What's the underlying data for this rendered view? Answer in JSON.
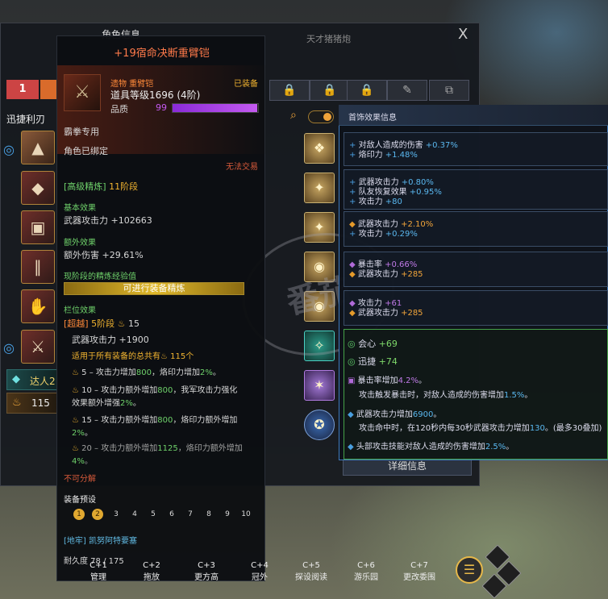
{
  "window": {
    "title": "角色信息",
    "subtitle": "天才猪猪炮",
    "close": "X",
    "tab_number": "1",
    "class_name": "迅捷利刃"
  },
  "left_panel": {
    "master_label": "达人2",
    "level_value": "115"
  },
  "detail_button": "详细信息",
  "tooltip": {
    "title": "+19宿命决断重臂铠",
    "category": "遗物 重臂铠",
    "equipped": "已装备",
    "item_level": "道具等级1696 (4阶)",
    "quality_label": "品质",
    "quality_value": "99",
    "quality_percent": 99,
    "class_restriction": "霸拳专用",
    "bound": "角色已绑定",
    "untradable": "无法交易",
    "refine_tag": "[高级精炼]",
    "refine_stage": "11阶段",
    "base_effect_header": "基本效果",
    "base_effect": "武器攻击力 +102663",
    "extra_effect_header": "额外效果",
    "extra_effect": "额外伤害 +29.61%",
    "refine_exp_header": "现阶段的精炼经验值",
    "refine_button": "可进行装备精炼",
    "slot_effect_header": "栏位效果",
    "transcend_tag": "[超越]",
    "transcend_stage": "5阶段",
    "transcend_value": "15",
    "weapon_attack": "武器攻击力 +1900",
    "total_all_prefix": "适用于所有装备的总共有",
    "total_all_value": "115个",
    "tier5_prefix": "5 – 攻击力增加",
    "tier5_value": "800",
    "tier5_suffix": "，烙印力增加",
    "tier5_value2": "2%",
    "tier5_end": "。",
    "tier10_prefix": "10 – 攻击力额外增加",
    "tier10_value": "800",
    "tier10_suffix": "，我军攻击力强化",
    "tier10_line2_prefix": "效果额外增强",
    "tier10_value2": "2%",
    "tier10_end": "。",
    "tier15_prefix": "15 – 攻击力额外增加",
    "tier15_value": "800",
    "tier15_suffix": "，烙印力额外增加",
    "tier15_value2": "2%",
    "tier15_end": "。",
    "tier20_prefix": "20 – 攻击力额外增加",
    "tier20_value": "1125",
    "tier20_suffix": "，烙印力额外增加",
    "tier20_value2": "4%",
    "tier20_end": "。",
    "indivisible": "不可分解",
    "preset_header": "装备预设",
    "presets": [
      "1",
      "2",
      "3",
      "4",
      "5",
      "6",
      "7",
      "8",
      "9",
      "10"
    ],
    "active_presets": 2,
    "dungeon": "[地牢] 凯努阿特要塞",
    "durability": "耐久度 78 / 175"
  },
  "accessory": {
    "header": "首饰效果信息",
    "groups": [
      [
        {
          "dot": "+",
          "c": "b",
          "label": "对敌人造成的伤害",
          "val": "+0.37%"
        },
        {
          "dot": "+",
          "c": "b",
          "label": "烙印力",
          "val": "+1.48%"
        }
      ],
      [
        {
          "dot": "+",
          "c": "b",
          "label": "武器攻击力",
          "val": "+0.80%"
        },
        {
          "dot": "+",
          "c": "b",
          "label": "队友恢复效果",
          "val": "+0.95%"
        },
        {
          "dot": "+",
          "c": "b",
          "label": "攻击力",
          "val": "+80"
        }
      ],
      [
        {
          "dot": "◆",
          "c": "o",
          "label": "武器攻击力",
          "val": "+2.10%"
        },
        {
          "dot": "+",
          "c": "b",
          "label": "攻击力",
          "val": "+0.29%"
        }
      ],
      [
        {
          "dot": "◆",
          "c": "p",
          "label": "暴击率",
          "val": "+0.66%"
        },
        {
          "dot": "◆",
          "c": "o",
          "label": "武器攻击力",
          "val": "+285"
        }
      ],
      [
        {
          "dot": "◆",
          "c": "p",
          "label": "攻击力",
          "val": "+61"
        },
        {
          "dot": "◆",
          "c": "o",
          "label": "武器攻击力",
          "val": "+285"
        }
      ]
    ],
    "set": {
      "crit": "会心",
      "crit_val": "+69",
      "swift": "迅捷",
      "swift_val": "+74",
      "crit_rate_prefix": "暴击率增加",
      "crit_rate_val": "4.2%",
      "crit_rate_end": "。",
      "crit_dmg_prefix": "攻击触发暴击时，对敌人造成的伤害增加",
      "crit_dmg_val": "1.5%",
      "crit_dmg_end": "。",
      "wpn_prefix": "武器攻击力增加",
      "wpn_val": "6900",
      "wpn_end": "。",
      "stack_prefix": "攻击命中时，在120秒内每30秒武器攻击力增加",
      "stack_val": "130",
      "stack_end": "。(最多30叠加)",
      "head_prefix": "头部攻击技能对敌人造成的伤害增加",
      "head_val": "2.5%",
      "head_end": "。"
    }
  },
  "hotkeys": [
    {
      "key": "C+1",
      "label": "管理"
    },
    {
      "key": "C+2",
      "label": "拖放"
    },
    {
      "key": "C+3",
      "label": "更方高"
    },
    {
      "key": "C+4",
      "label": "冠外"
    },
    {
      "key": "C+5",
      "label": "探设阅读"
    },
    {
      "key": "C+6",
      "label": "游乐园"
    },
    {
      "key": "C+7",
      "label": "更改委围"
    }
  ]
}
